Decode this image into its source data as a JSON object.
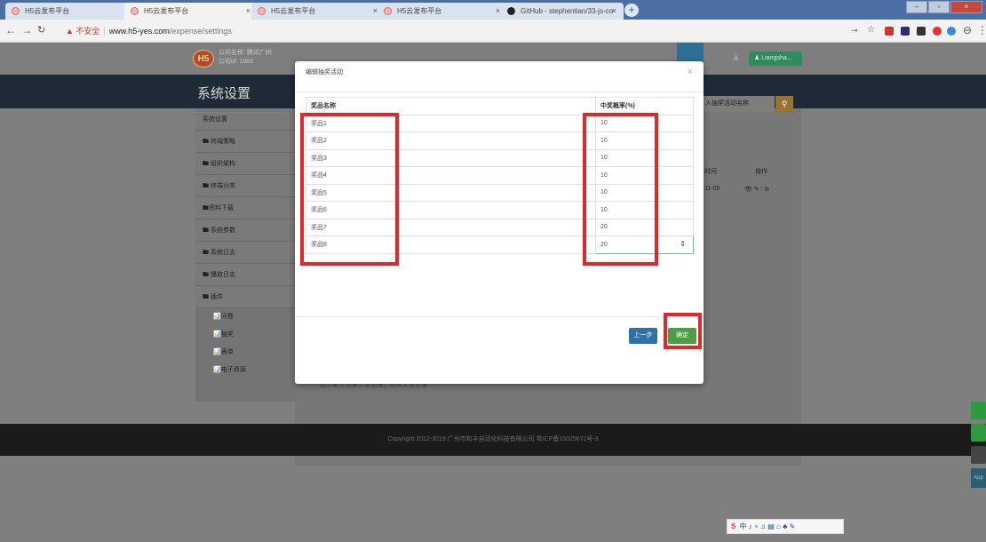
{
  "browser": {
    "tabs": [
      {
        "label": "H5云发布平台",
        "close": "×",
        "icon": "h5-favicon"
      },
      {
        "label": "H5云发布平台",
        "close": "×",
        "icon": "h5-favicon",
        "active": true
      },
      {
        "label": "H5云发布平台",
        "close": "×",
        "icon": "h5-favicon"
      },
      {
        "label": "H5云发布平台",
        "close": "×",
        "icon": "h5-favicon"
      },
      {
        "label": "GitHub - stephentian/33-js-co",
        "close": "×",
        "icon": "github-icon"
      }
    ],
    "new_tab": "+",
    "address": {
      "warning": "▲ 不安全",
      "host": "www.h5-yes.com",
      "path": "/expense/settings"
    }
  },
  "header": {
    "logo": "H5",
    "company_name": "公司名称: 腾讯广州",
    "company_id": "公司id: 1083",
    "user": "Liangsha..."
  },
  "page": {
    "title": "系统设置",
    "sidebar": {
      "items": [
        "系统设置",
        "🖿 终端策略",
        "🖿 组织架构",
        "🖿 终端分类",
        "🖿资料下载",
        "🖿 系统参数",
        "🖿 系统日志",
        "🖿 播放日志",
        "🖿 插件"
      ],
      "subitems": [
        "📊问卷",
        "📊抽奖",
        "📊表单",
        "📊电子资源"
      ]
    },
    "search_placeholder": "入抽奖活动名称",
    "columns": [
      "时间",
      "操作"
    ],
    "row_date": "11-05",
    "row_actions": "👁 ✎ ⫶ ⊖",
    "pagination": "显示第 1 到第 1 条记录，总共 1 条记录",
    "close_button": "关闭",
    "footer": "Copyright 2012-2019 广州市和丰自动化科技有限公司 粤ICP备15025672号-3",
    "app_tab": "App"
  },
  "modal": {
    "title": "编辑抽奖活动",
    "close": "×",
    "col_name": "奖品名称",
    "col_rate": "中奖概率(%)",
    "rows": [
      {
        "name": "奖品1",
        "rate": "10"
      },
      {
        "name": "奖品2",
        "rate": "10"
      },
      {
        "name": "奖品3",
        "rate": "10"
      },
      {
        "name": "奖品4",
        "rate": "10"
      },
      {
        "name": "奖品5",
        "rate": "10"
      },
      {
        "name": "奖品6",
        "rate": "10"
      },
      {
        "name": "奖品7",
        "rate": "20"
      },
      {
        "name": "奖品8",
        "rate": "20"
      }
    ],
    "prev_button": "上一步",
    "ok_button": "确定"
  },
  "colors": {
    "highlight": "#e02828",
    "ok_green": "#4a9e45",
    "prev_blue": "#2e72a8",
    "tab_bar": "#4a6fa5"
  }
}
